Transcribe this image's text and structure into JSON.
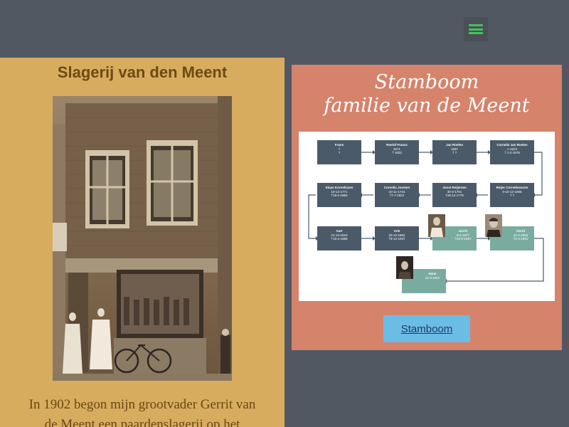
{
  "colors": {
    "page_bg": "#525862",
    "left_panel_bg": "#d7ac5f",
    "right_panel_bg": "#d5836b",
    "menu_icon": "#49c25a",
    "button_bg": "#6cbde6",
    "node_dark": "#4b5a69",
    "node_green": "#7aaba1"
  },
  "header": {
    "menu_icon": "hamburger-icon"
  },
  "left": {
    "title": "Slagerij van den Meent",
    "intro_line1": "In 1902 begon mijn grootvader Gerrit van",
    "intro_line2": "de Meent een paardenslagerij op het"
  },
  "right": {
    "title_line1": "Stamboom",
    "title_line2": "familie van de Meent",
    "button_label": "Stamboom",
    "tree": {
      "nodes": [
        {
          "name": "Frans",
          "l1": "?",
          "l2": "?"
        },
        {
          "name": "Roelof Fransz",
          "l1": "1571",
          "l2": "† 1602"
        },
        {
          "name": "Jan Roelen",
          "l1": "1597",
          "l2": "† ?"
        },
        {
          "name": "Cornelis Jan Roelen",
          "l1": "1-1624",
          "l2": "† 1-2-1676"
        },
        {
          "name": "Klaas Korneliszen",
          "l1": "10-12-1771",
          "l2": "†19-2-1860"
        },
        {
          "name": "Cornelis Joosten",
          "l1": "10-11-1744",
          "l2": "†7-7-1821"
        },
        {
          "name": "Joost Reijersen",
          "l1": "30-3-1701",
          "l2": "†18-12-1778"
        },
        {
          "name": "Reijer Cornelisszoon",
          "l1": "0-10-12-1665",
          "l2": "† ?"
        },
        {
          "name": "Aart",
          "l1": "21-10-1810",
          "l2": "†19-4-1898"
        },
        {
          "name": "Arie",
          "l1": "30-12-1862",
          "l2": "†8-12-1937"
        },
        {
          "name": "Gerrit",
          "l1": "8-2-1877",
          "l2": "†22-9-1957"
        },
        {
          "name": "Gerrit",
          "l1": "12-2-1905",
          "l2": "†2-3-1991"
        },
        {
          "name": "Hans",
          "l1": "12-3-1951",
          "l2": ""
        }
      ]
    }
  }
}
